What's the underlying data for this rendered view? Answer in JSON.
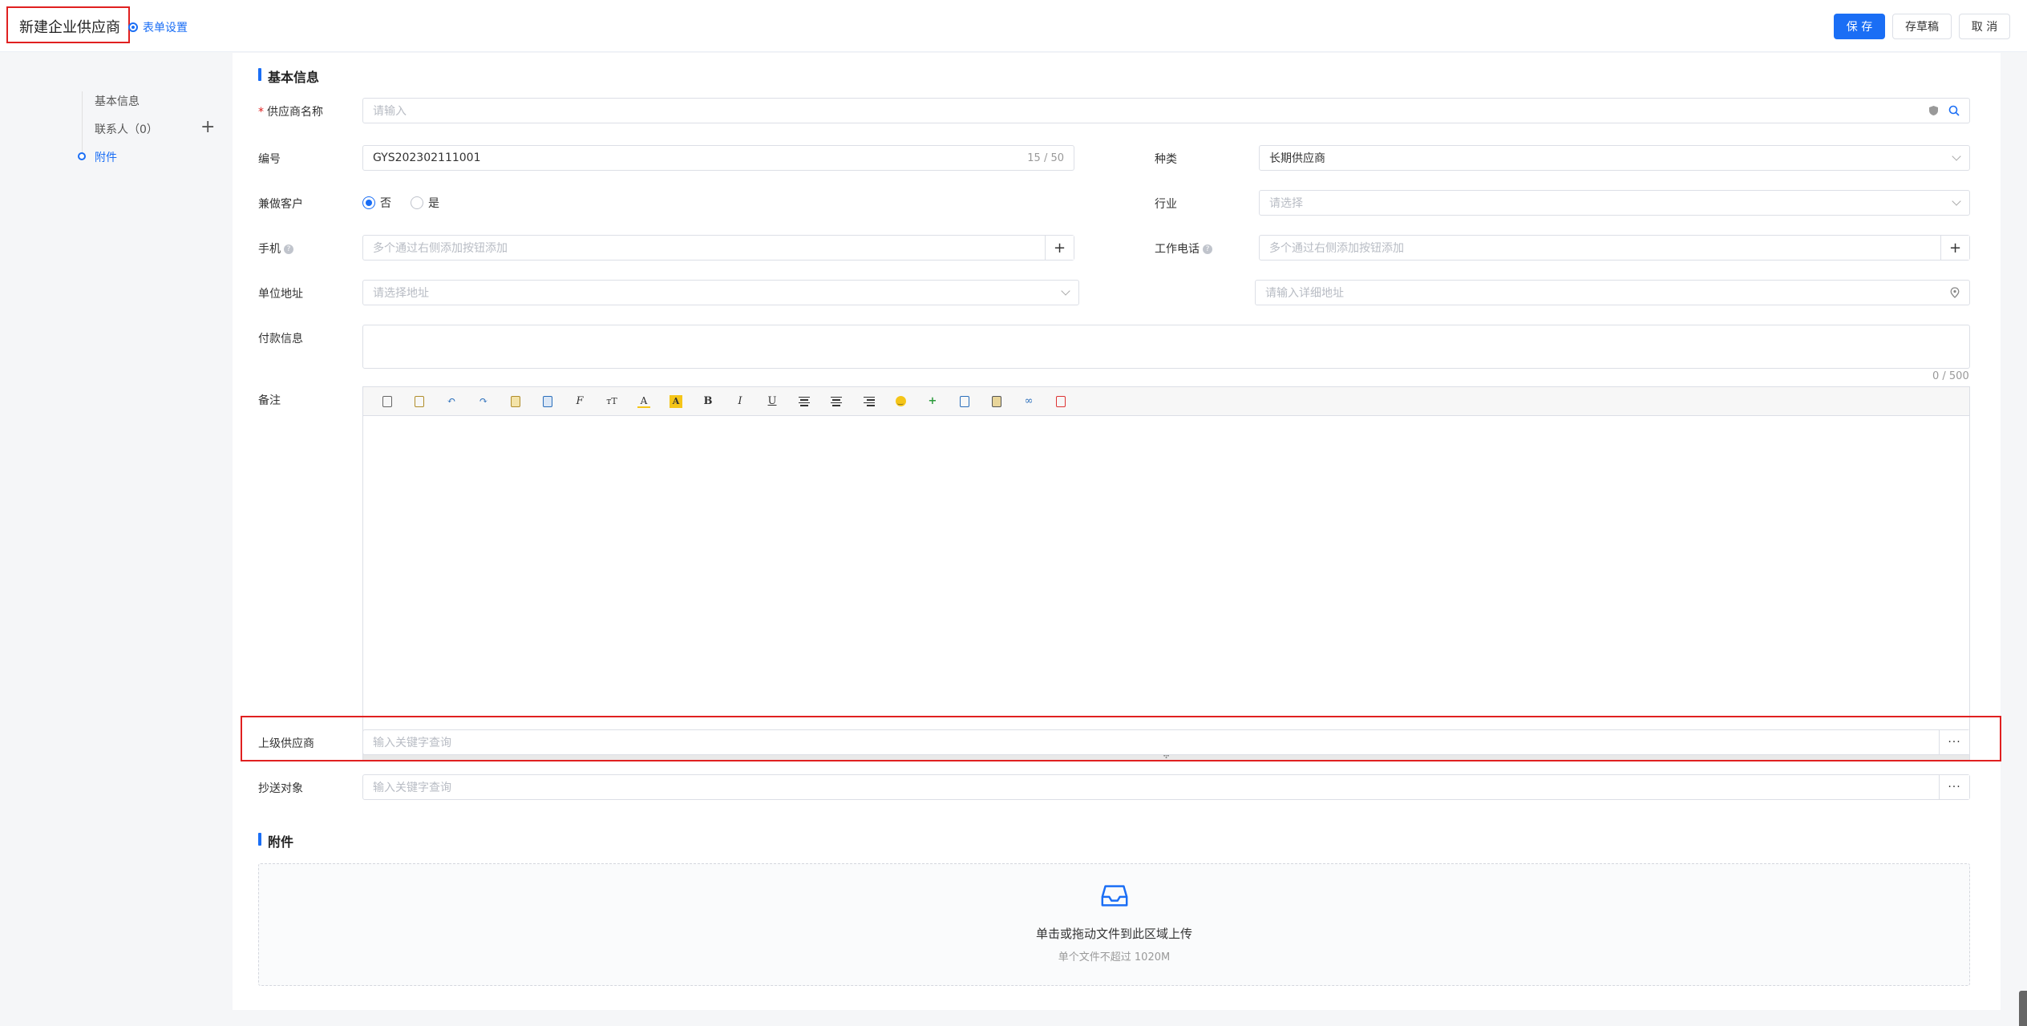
{
  "header": {
    "title": "新建企业供应商",
    "form_settings": "表单设置",
    "save": "保 存",
    "draft": "存草稿",
    "cancel": "取 消"
  },
  "sidenav": {
    "items": [
      {
        "label": "基本信息"
      },
      {
        "label": "联系人（0）"
      },
      {
        "label": "附件"
      }
    ],
    "active": "附件"
  },
  "basic": {
    "section_title": "基本信息",
    "supplier_name": {
      "label": "供应商名称",
      "required": "*",
      "placeholder": "请输入"
    },
    "code": {
      "label": "编号",
      "value": "GYS202302111001",
      "count": "15 / 50"
    },
    "category": {
      "label": "种类",
      "value": "长期供应商"
    },
    "also_customer": {
      "label": "兼做客户",
      "options": [
        "否",
        "是"
      ],
      "selected": "否"
    },
    "industry": {
      "label": "行业",
      "placeholder": "请选择"
    },
    "mobile": {
      "label": "手机",
      "placeholder": "多个通过右侧添加按钮添加",
      "add": "+"
    },
    "work_phone": {
      "label": "工作电话",
      "placeholder": "多个通过右侧添加按钮添加",
      "add": "+"
    },
    "address": {
      "label": "单位地址",
      "placeholder": "请选择地址"
    },
    "address_detail": {
      "placeholder": "请输入详细地址"
    },
    "payment": {
      "label": "付款信息",
      "count": "0 / 500"
    },
    "remark": {
      "label": "备注"
    },
    "parent_supplier": {
      "label": "上级供应商",
      "placeholder": "输入关键字查询",
      "more": "···"
    },
    "cc_target": {
      "label": "抄送对象",
      "placeholder": "输入关键字查询",
      "more": "···"
    }
  },
  "editor_toolbar": [
    "source-icon",
    "template-icon",
    "undo-icon",
    "redo-icon",
    "paste-icon",
    "paste-word-icon",
    "font-family-icon",
    "font-size-icon",
    "font-color-icon",
    "highlight-icon",
    "bold-icon",
    "italic-icon",
    "underline-icon",
    "align-left-icon",
    "align-center-icon",
    "align-right-icon",
    "emoji-icon",
    "insert-row-icon",
    "table-icon",
    "image-icon",
    "link-icon",
    "fullscreen-icon"
  ],
  "attachment": {
    "section_title": "附件",
    "upload_text": "单击或拖动文件到此区域上传",
    "upload_hint": "单个文件不超过 1020M"
  },
  "colors": {
    "primary": "#1a6ef5",
    "annotation_red": "#e02020"
  }
}
